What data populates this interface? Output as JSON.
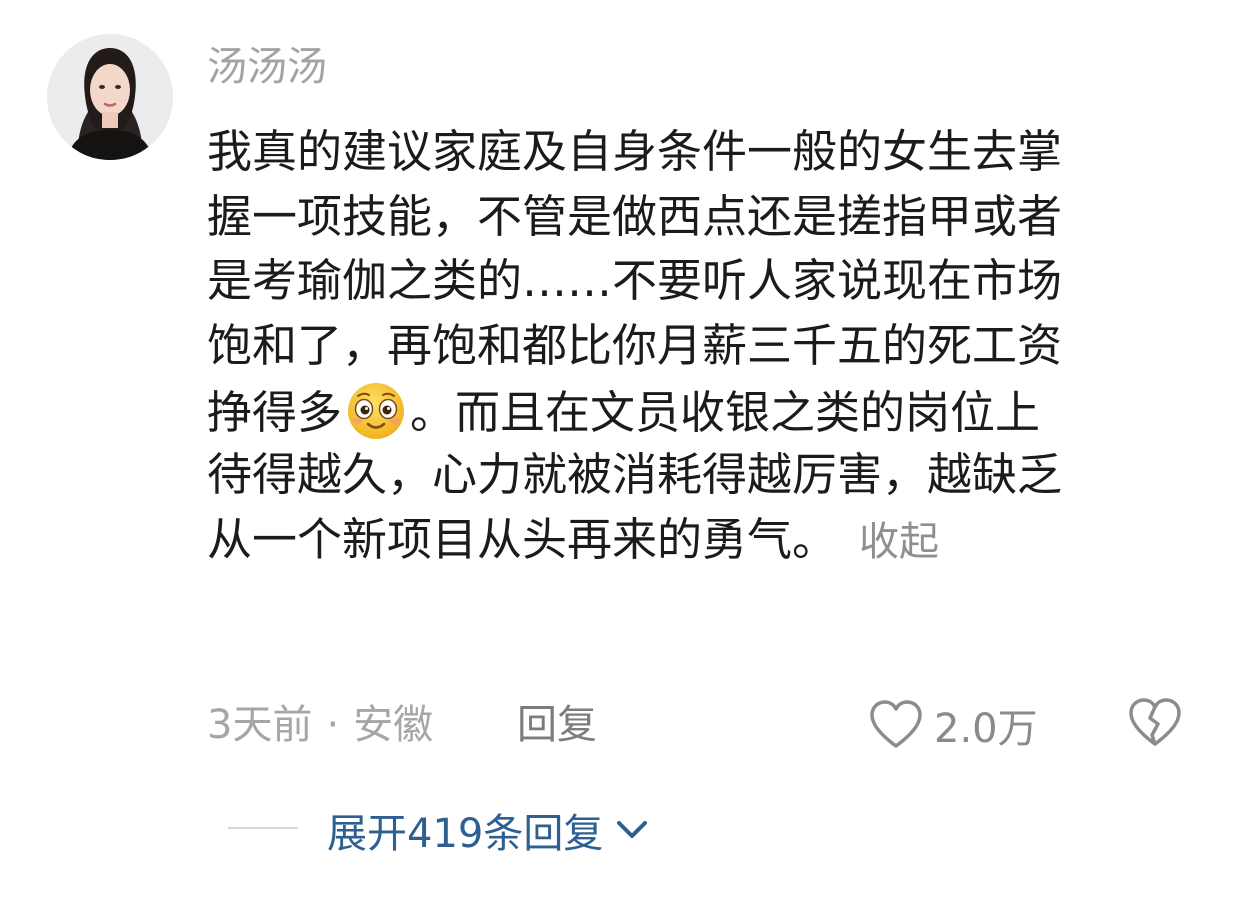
{
  "comment": {
    "username": "汤汤汤",
    "lines": [
      "我真的建议家庭及自身条件一般的女生去掌",
      "握一项技能，不管是做西点还是搓指甲或者",
      "是考瑜伽之类的……不要听人家说现在市场",
      "饱和了，再饱和都比你月薪三千五的死工资"
    ],
    "line5_before_emoji": "挣得多",
    "line5_after_emoji": "。而且在文员收银之类的岗位上",
    "line6": "待得越久，心力就被消耗得越厉害，越缺乏",
    "line7": "从一个新项目从头再来的勇气。",
    "collapse_label": "收起",
    "emoji_icon": "smiling-face-emoji-icon"
  },
  "meta": {
    "time": "3天前",
    "separator": "·",
    "location": "安徽",
    "reply_label": "回复",
    "like_count": "2.0万"
  },
  "expand": {
    "label": "展开419条回复"
  },
  "colors": {
    "body_text": "#1b1b1b",
    "secondary_text": "#a6a6a6",
    "link_blue": "#2d5f91",
    "emoji_yellow": "#f7c52b"
  }
}
